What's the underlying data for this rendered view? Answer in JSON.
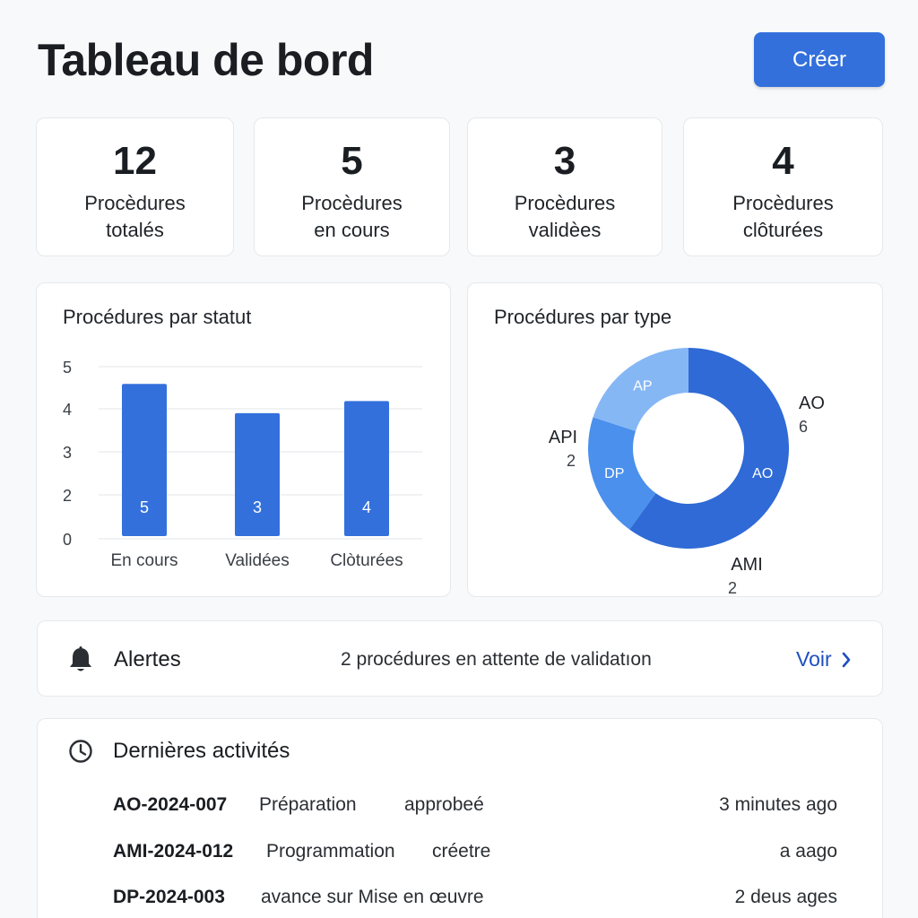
{
  "header": {
    "title": "Tableau de bord",
    "create_label": "Créer"
  },
  "stats": [
    {
      "value": "12",
      "line1": "Procèdures",
      "line2": "totalés"
    },
    {
      "value": "5",
      "line1": "Procèdures",
      "line2": "en cours"
    },
    {
      "value": "3",
      "line1": "Procèdures",
      "line2": "validèes"
    },
    {
      "value": "4",
      "line1": "Procèdures",
      "line2": "clôturées"
    }
  ],
  "panels": {
    "status_title": "Procédures par statut",
    "type_title": "Procédures par type"
  },
  "chart_data": [
    {
      "type": "bar",
      "title": "Procédures par statut",
      "categories": [
        "En cours",
        "Validées",
        "Clòturées"
      ],
      "values": [
        5,
        3,
        4
      ],
      "bar_heights": [
        4.5,
        3.65,
        4.0
      ],
      "yticks": [
        "5",
        "4",
        "3",
        "2",
        "0"
      ],
      "color": "#3370dc"
    },
    {
      "type": "pie",
      "title": "Procédures par type",
      "slices": [
        {
          "inner": "AO",
          "label": "AO",
          "value": 6,
          "value_label": "6",
          "color": "#2f6ad6"
        },
        {
          "inner": "DP",
          "label": "AMI",
          "value": 2,
          "value_label": "2",
          "color": "#4a90ec"
        },
        {
          "inner": "AP",
          "label": "API",
          "value": 2,
          "value_label": "2",
          "color": "#86b7f5"
        }
      ]
    }
  ],
  "alert": {
    "title": "Alertes",
    "text": "2 procédures en attente de  validatıon",
    "action": "Voir"
  },
  "activities": {
    "title": "Dernières activités",
    "rows": [
      {
        "code": "AO-2024-007",
        "desc": "Préparation",
        "status": "approbeé",
        "time": "3 minutes ago"
      },
      {
        "code": "AMI-2024-012",
        "desc": "Programmation",
        "status": "créetre",
        "time": "a aago"
      },
      {
        "code": "DP-2024-003",
        "desc": "avance sur Mise en œuvre",
        "status": "",
        "time": "2 deus ages"
      }
    ]
  }
}
